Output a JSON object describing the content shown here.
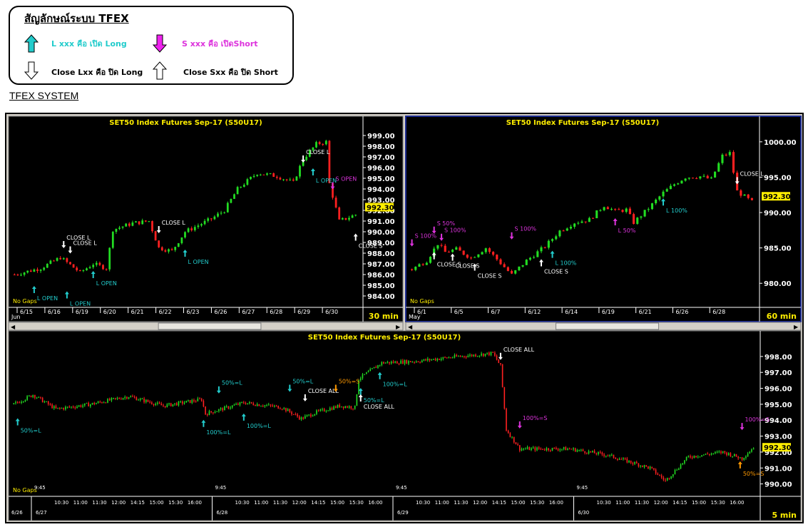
{
  "legend": {
    "title": "สัญลักษณ์ระบบ TFEX",
    "long_open": "L xxx คือ เปิด Long",
    "short_open": "S xxx คือ เปิดShort",
    "long_close": "Close Lxx คือ ปิด Long",
    "short_close": "Close Sxx คือ ปิด Short",
    "icons": [
      "arrow-up-cyan-icon",
      "arrow-down-magenta-icon",
      "arrow-down-outline-icon",
      "arrow-up-outline-icon"
    ]
  },
  "system_title": "TFEX SYSTEM",
  "colors": {
    "up": "#22dd22",
    "down": "#ff2020",
    "long": "#22cccc",
    "short": "#dd33dd",
    "close": "#ffffff",
    "orange": "#ff9900",
    "panel": "#000000",
    "title": "#ffee00",
    "last_price_bg": "#ffee00"
  },
  "chart_data": [
    {
      "type": "candlestick",
      "title": "SET50  Index  Futures  Sep-17  (S50U17)",
      "timeframe": "30  min",
      "gaps_label": "No Gaps",
      "month_label": "Jun",
      "x_labels": [
        "6/15",
        "6/16",
        "6/19",
        "6/20",
        "6/21",
        "6/22",
        "6/23",
        "6/26",
        "6/27",
        "6/28",
        "6/29",
        "6/30"
      ],
      "y_ticks": [
        "999.00",
        "998.00",
        "997.00",
        "996.00",
        "995.00",
        "994.00",
        "993.00",
        "992.00",
        "991.00",
        "990.00",
        "989.00",
        "988.00",
        "987.00",
        "986.00",
        "985.00",
        "984.00"
      ],
      "ylim": [
        983.2,
        999.6
      ],
      "last_price": "992.30",
      "path": [
        [
          0,
          986.0
        ],
        [
          8,
          986.6
        ],
        [
          14,
          987.6
        ],
        [
          20,
          986.2
        ],
        [
          24,
          987.0
        ],
        [
          28,
          986.6
        ],
        [
          30,
          990.2
        ],
        [
          36,
          990.8
        ],
        [
          41,
          991.0
        ],
        [
          44,
          988.5
        ],
        [
          48,
          988.2
        ],
        [
          52,
          990.0
        ],
        [
          56,
          990.6
        ],
        [
          60,
          991.2
        ],
        [
          64,
          992.0
        ],
        [
          68,
          994.0
        ],
        [
          74,
          995.5
        ],
        [
          80,
          995.2
        ],
        [
          85,
          994.6
        ],
        [
          88,
          996.8
        ],
        [
          92,
          998.2
        ],
        [
          95,
          998.4
        ],
        [
          96,
          994.5
        ],
        [
          99,
          991.0
        ],
        [
          104,
          991.6
        ]
      ],
      "annotations": [
        {
          "text": "L  OPEN",
          "color": "long",
          "arrow": "up",
          "x": 6,
          "y": 985.2,
          "below": true
        },
        {
          "text": "L  OPEN",
          "color": "long",
          "arrow": "up",
          "x": 16,
          "y": 984.7,
          "below": true
        },
        {
          "text": "CLOSE  L",
          "color": "close",
          "arrow": "down",
          "x": 15,
          "y": 988.2,
          "below": false
        },
        {
          "text": "CLOSE  L",
          "color": "close",
          "arrow": "down",
          "x": 17,
          "y": 987.7,
          "below": false
        },
        {
          "text": "L  OPEN",
          "color": "long",
          "arrow": "up",
          "x": 24,
          "y": 986.6,
          "below": true
        },
        {
          "text": "CLOSE  L",
          "color": "close",
          "arrow": "down",
          "x": 44,
          "y": 989.6,
          "below": false
        },
        {
          "text": "L  OPEN",
          "color": "long",
          "arrow": "up",
          "x": 52,
          "y": 988.6,
          "below": true
        },
        {
          "text": "CLOSE  L",
          "color": "close",
          "arrow": "down",
          "x": 88,
          "y": 996.2,
          "below": false
        },
        {
          "text": "L  OPEN",
          "color": "long",
          "arrow": "up",
          "x": 91,
          "y": 996.2,
          "below": true
        },
        {
          "text": "S  OPEN",
          "color": "short",
          "arrow": "down",
          "x": 97,
          "y": 993.7,
          "below": false
        },
        {
          "text": "CLOSE  S",
          "color": "close",
          "arrow": "up",
          "x": 104,
          "y": 990.1,
          "below": true
        }
      ]
    },
    {
      "type": "candlestick",
      "title": "SET50  Index  Futures  Sep-17  (S50U17)",
      "timeframe": "60  min",
      "gaps_label": "No Gaps",
      "month_label": "May",
      "x_labels": [
        "6/1",
        "6/5",
        "6/7",
        "6/12",
        "6/14",
        "6/19",
        "6/21",
        "6/26",
        "6/28"
      ],
      "y_ticks": [
        "1000.00",
        "995.00",
        "990.00",
        "985.00",
        "980.00"
      ],
      "ylim": [
        977.0,
        1001.8
      ],
      "last_price": "992.30",
      "path": [
        [
          0,
          982.0
        ],
        [
          4,
          983.2
        ],
        [
          7,
          985.6
        ],
        [
          9,
          984.4
        ],
        [
          12,
          984.8
        ],
        [
          16,
          983.6
        ],
        [
          20,
          985.0
        ],
        [
          23,
          983.4
        ],
        [
          27,
          981.2
        ],
        [
          31,
          983.2
        ],
        [
          36,
          985.2
        ],
        [
          40,
          987.4
        ],
        [
          44,
          988.6
        ],
        [
          48,
          989.0
        ],
        [
          52,
          991.0
        ],
        [
          55,
          990.2
        ],
        [
          58,
          990.4
        ],
        [
          60,
          988.6
        ],
        [
          64,
          990.6
        ],
        [
          68,
          992.8
        ],
        [
          71,
          994.0
        ],
        [
          74,
          995.0
        ],
        [
          78,
          995.1
        ],
        [
          81,
          994.7
        ],
        [
          84,
          998.0
        ],
        [
          86,
          998.4
        ],
        [
          88,
          993.0
        ],
        [
          92,
          991.5
        ]
      ],
      "annotations": [
        {
          "text": "S  100%",
          "color": "short",
          "arrow": "down",
          "x": 0,
          "y": 984.8,
          "below": false
        },
        {
          "text": "S  50%",
          "color": "short",
          "arrow": "down",
          "x": 6,
          "y": 986.6,
          "below": false
        },
        {
          "text": "S  100%",
          "color": "short",
          "arrow": "down",
          "x": 8,
          "y": 985.6,
          "below": false
        },
        {
          "text": "CLOSE  S",
          "color": "close",
          "arrow": "up",
          "x": 6,
          "y": 984.8,
          "below": true
        },
        {
          "text": "CLOSE  S",
          "color": "close",
          "arrow": "up",
          "x": 11,
          "y": 984.6,
          "below": true
        },
        {
          "text": "CLOSE  S",
          "color": "close",
          "arrow": "up",
          "x": 17,
          "y": 983.2,
          "below": true
        },
        {
          "text": "S  100%",
          "color": "short",
          "arrow": "down",
          "x": 27,
          "y": 985.8,
          "below": false
        },
        {
          "text": "CLOSE  S",
          "color": "close",
          "arrow": "up",
          "x": 35,
          "y": 983.8,
          "below": true
        },
        {
          "text": "L  100%",
          "color": "long",
          "arrow": "up",
          "x": 38,
          "y": 985.0,
          "below": true
        },
        {
          "text": "L  50%",
          "color": "short",
          "arrow": "up",
          "x": 55,
          "y": 989.6,
          "below": true
        },
        {
          "text": "L  100%",
          "color": "long",
          "arrow": "up",
          "x": 68,
          "y": 992.4,
          "below": true
        },
        {
          "text": "CLOSE  L",
          "color": "close",
          "arrow": "down",
          "x": 88,
          "y": 993.6,
          "below": false
        }
      ]
    },
    {
      "type": "candlestick",
      "title": "SET50  Index  Futures  Sep-17  (S50U17)",
      "timeframe": "5  min",
      "gaps_label": "No Gaps",
      "date_labels": [
        "6/26",
        "6/27",
        "6/28",
        "6/29",
        "6/30"
      ],
      "time_labels": [
        "9:45",
        "10:30",
        "11:00",
        "11:30",
        "12:00",
        "14:15",
        "15:00",
        "15:30",
        "16:00"
      ],
      "y_ticks": [
        "998.00",
        "997.00",
        "996.00",
        "995.00",
        "994.00",
        "993.00",
        "992.00",
        "991.00",
        "990.00"
      ],
      "ylim": [
        989.4,
        998.8
      ],
      "last_price": "992.30",
      "path": [
        [
          0,
          995.0
        ],
        [
          10,
          995.6
        ],
        [
          22,
          994.7
        ],
        [
          40,
          995.0
        ],
        [
          60,
          995.5
        ],
        [
          78,
          994.9
        ],
        [
          98,
          995.3
        ],
        [
          100,
          994.4
        ],
        [
          120,
          995.1
        ],
        [
          140,
          994.8
        ],
        [
          150,
          994.1
        ],
        [
          158,
          994.5
        ],
        [
          170,
          994.9
        ],
        [
          178,
          994.8
        ],
        [
          180,
          996.6
        ],
        [
          192,
          997.6
        ],
        [
          210,
          997.7
        ],
        [
          232,
          998.0
        ],
        [
          250,
          998.2
        ],
        [
          254,
          997.4
        ],
        [
          257,
          993.4
        ],
        [
          264,
          992.2
        ],
        [
          290,
          992.2
        ],
        [
          310,
          991.8
        ],
        [
          332,
          991.0
        ],
        [
          340,
          990.2
        ],
        [
          352,
          991.7
        ],
        [
          370,
          992.0
        ],
        [
          380,
          991.6
        ],
        [
          386,
          992.3
        ]
      ],
      "annotations": [
        {
          "text": "50%=L",
          "color": "long",
          "arrow": "up",
          "x": 2,
          "y": 994.3,
          "below": true
        },
        {
          "text": "50%=L",
          "color": "long",
          "arrow": "down",
          "x": 107,
          "y": 995.5,
          "below": false
        },
        {
          "text": "100%=L",
          "color": "long",
          "arrow": "up",
          "x": 99,
          "y": 994.2,
          "below": true
        },
        {
          "text": "100%=L",
          "color": "long",
          "arrow": "up",
          "x": 120,
          "y": 994.6,
          "below": true
        },
        {
          "text": "50%=L",
          "color": "long",
          "arrow": "down",
          "x": 144,
          "y": 995.6,
          "below": false
        },
        {
          "text": "CLOSE  ALL",
          "color": "close",
          "arrow": "down",
          "x": 152,
          "y": 995.0,
          "below": false
        },
        {
          "text": "50%=S",
          "color": "orange",
          "arrow": "down",
          "x": 168,
          "y": 995.6,
          "below": false
        },
        {
          "text": "50%=L",
          "color": "long",
          "arrow": "up",
          "x": 181,
          "y": 996.2,
          "below": true
        },
        {
          "text": "CLOSE  ALL",
          "color": "close",
          "arrow": "up",
          "x": 181,
          "y": 995.8,
          "below": true
        },
        {
          "text": "100%=L",
          "color": "long",
          "arrow": "up",
          "x": 191,
          "y": 997.2,
          "below": true
        },
        {
          "text": "CLOSE  ALL",
          "color": "close",
          "arrow": "down",
          "x": 254,
          "y": 997.6,
          "below": false
        },
        {
          "text": "100%=S",
          "color": "short",
          "arrow": "down",
          "x": 264,
          "y": 993.3,
          "below": false
        },
        {
          "text": "100%=S",
          "color": "short",
          "arrow": "down",
          "x": 380,
          "y": 993.2,
          "below": false
        },
        {
          "text": "50%=S",
          "color": "orange",
          "arrow": "up",
          "x": 379,
          "y": 991.6,
          "below": true
        }
      ]
    }
  ]
}
